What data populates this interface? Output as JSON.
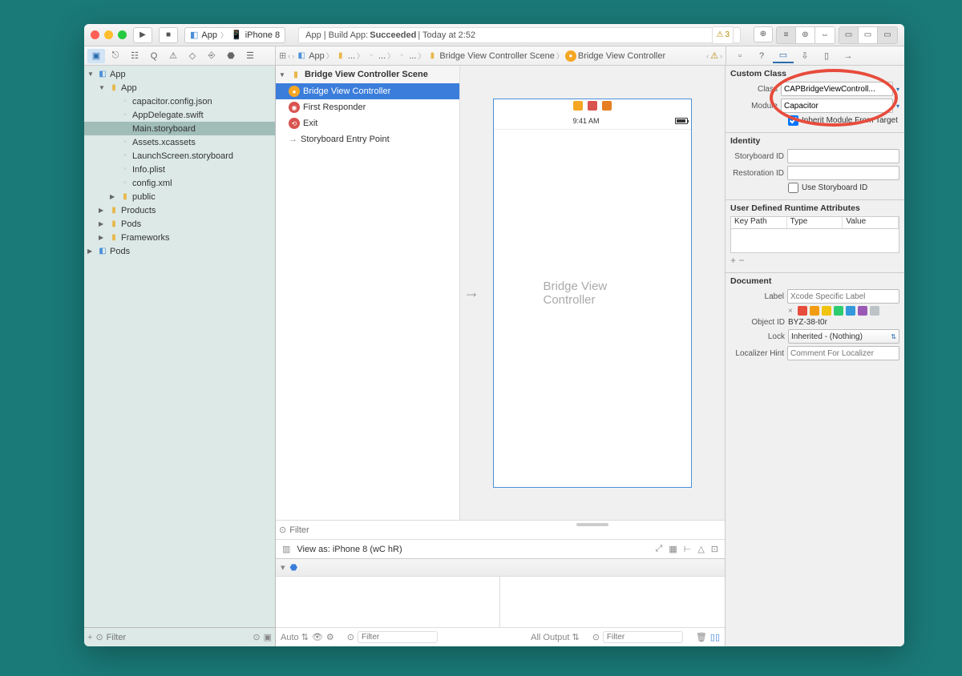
{
  "titlebar": {
    "scheme_app": "App",
    "scheme_device": "iPhone 8",
    "status_prefix": "App | Build App: ",
    "status_bold": "Succeeded",
    "status_suffix": " | Today at 2:52",
    "warn_count": "3"
  },
  "navigator_tabs": [
    "folder",
    "scm",
    "search",
    "warn",
    "test",
    "debug",
    "break",
    "report"
  ],
  "project_tree": {
    "root": "App",
    "items": [
      {
        "label": "App",
        "type": "folder",
        "indent": 1,
        "open": true
      },
      {
        "label": "capacitor.config.json",
        "type": "file",
        "indent": 2
      },
      {
        "label": "AppDelegate.swift",
        "type": "file",
        "indent": 2
      },
      {
        "label": "Main.storyboard",
        "type": "file",
        "indent": 2,
        "selected": true
      },
      {
        "label": "Assets.xcassets",
        "type": "file",
        "indent": 2
      },
      {
        "label": "LaunchScreen.storyboard",
        "type": "file",
        "indent": 2
      },
      {
        "label": "Info.plist",
        "type": "file",
        "indent": 2
      },
      {
        "label": "config.xml",
        "type": "file",
        "indent": 2
      },
      {
        "label": "public",
        "type": "folder",
        "indent": 2,
        "open": false
      },
      {
        "label": "Products",
        "type": "folder",
        "indent": 1,
        "open": false
      },
      {
        "label": "Pods",
        "type": "folder",
        "indent": 1,
        "open": false
      },
      {
        "label": "Frameworks",
        "type": "folder",
        "indent": 1,
        "open": false
      }
    ],
    "pods_root": "Pods"
  },
  "sidebar_footer": {
    "filter_placeholder": "Filter"
  },
  "breadcrumb": [
    "App",
    "...",
    "...",
    "...",
    "Bridge View Controller Scene",
    "Bridge View Controller"
  ],
  "outline": {
    "header": "Bridge View Controller Scene",
    "rows": [
      {
        "label": "Bridge View Controller",
        "icon": "vc",
        "selected": true
      },
      {
        "label": "First Responder",
        "icon": "fr"
      },
      {
        "label": "Exit",
        "icon": "ex"
      },
      {
        "label": "Storyboard Entry Point",
        "icon": "arrow"
      }
    ],
    "filter_placeholder": "Filter"
  },
  "canvas": {
    "phone_time": "9:41 AM",
    "phone_title": "Bridge View Controller"
  },
  "viewas": {
    "label": "View as: iPhone 8 (wC hR)"
  },
  "debug": {
    "auto": "Auto",
    "all_output": "All Output",
    "filter_placeholder": "Filter"
  },
  "inspector": {
    "custom_class": {
      "title": "Custom Class",
      "class_label": "Class",
      "class_value": "CAPBridgeViewControll...",
      "module_label": "Module",
      "module_value": "Capacitor",
      "inherit_label": "Inherit Module From Target"
    },
    "identity": {
      "title": "Identity",
      "storyboard_label": "Storyboard ID",
      "storyboard_value": "",
      "restoration_label": "Restoration ID",
      "restoration_value": "",
      "use_sb_label": "Use Storyboard ID"
    },
    "runtime": {
      "title": "User Defined Runtime Attributes",
      "cols": [
        "Key Path",
        "Type",
        "Value"
      ]
    },
    "document": {
      "title": "Document",
      "label_label": "Label",
      "label_placeholder": "Xcode Specific Label",
      "colors": [
        "#e74c3c",
        "#f39c12",
        "#f1c40f",
        "#2ecc71",
        "#3498db",
        "#9b59b6",
        "#bdc3c7"
      ],
      "objectid_label": "Object ID",
      "objectid_value": "BYZ-38-t0r",
      "lock_label": "Lock",
      "lock_value": "Inherited - (Nothing)",
      "localizer_label": "Localizer Hint",
      "localizer_placeholder": "Comment For Localizer"
    }
  }
}
